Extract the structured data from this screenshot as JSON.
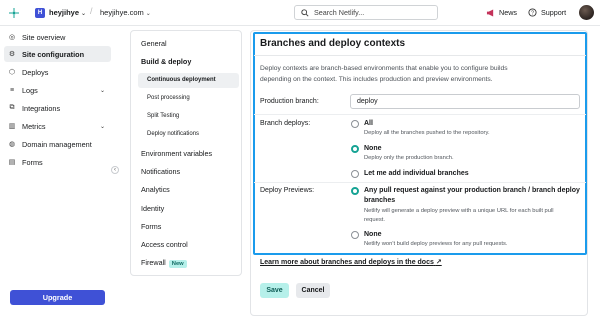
{
  "topbar": {
    "team_initial": "H",
    "team_name": "heyjihye",
    "site_name": "heyjihye.com",
    "search_placeholder": "Search Netlify...",
    "news_label": "News",
    "support_label": "Support"
  },
  "sidebar": {
    "items": [
      {
        "label": "Site overview",
        "icon": "globe-icon"
      },
      {
        "label": "Site configuration",
        "icon": "gear-icon"
      },
      {
        "label": "Deploys",
        "icon": "deploy-icon"
      },
      {
        "label": "Logs",
        "icon": "logs-icon"
      },
      {
        "label": "Integrations",
        "icon": "integrations-icon"
      },
      {
        "label": "Metrics",
        "icon": "metrics-icon"
      },
      {
        "label": "Domain management",
        "icon": "domain-icon"
      },
      {
        "label": "Forms",
        "icon": "forms-icon"
      }
    ],
    "upgrade_label": "Upgrade"
  },
  "subnav": {
    "general": "General",
    "build_deploy": "Build & deploy",
    "children": [
      "Continuous deployment",
      "Post processing",
      "Split Testing",
      "Deploy notifications"
    ],
    "sections": [
      "Environment variables",
      "Notifications",
      "Analytics",
      "Identity",
      "Forms",
      "Access control"
    ],
    "firewall": "Firewall",
    "new_badge": "New"
  },
  "main": {
    "title": "Branches and deploy contexts",
    "description": "Deploy contexts are branch-based environments that enable you to configure builds depending on the context. This includes production and preview environments.",
    "production_branch_label": "Production branch:",
    "production_branch_value": "deploy",
    "branch_deploys_label": "Branch deploys:",
    "branch_options": [
      {
        "label": "All",
        "help": "Deploy all the branches pushed to the repository.",
        "selected": false
      },
      {
        "label": "None",
        "help": "Deploy only the production branch.",
        "selected": true
      },
      {
        "label": "Let me add individual branches",
        "help": "",
        "selected": false
      }
    ],
    "deploy_previews_label": "Deploy Previews:",
    "preview_option_any_line1": "Any pull request against your production branch / branch deploy",
    "preview_option_any_line2": "branches",
    "preview_option_any_help1": "Netlify will generate a deploy preview with a unique URL for each built pull",
    "preview_option_any_help2": "request.",
    "preview_option_none": "None",
    "preview_option_none_help": "Netlify won't build deploy previews for any pull requests.",
    "learn_more": "Learn more about branches and deploys in the docs",
    "save_label": "Save",
    "cancel_label": "Cancel"
  },
  "colors": {
    "accent_blue": "#3f51d6",
    "highlight_border": "#1a9bec",
    "teal": "#16a394"
  }
}
